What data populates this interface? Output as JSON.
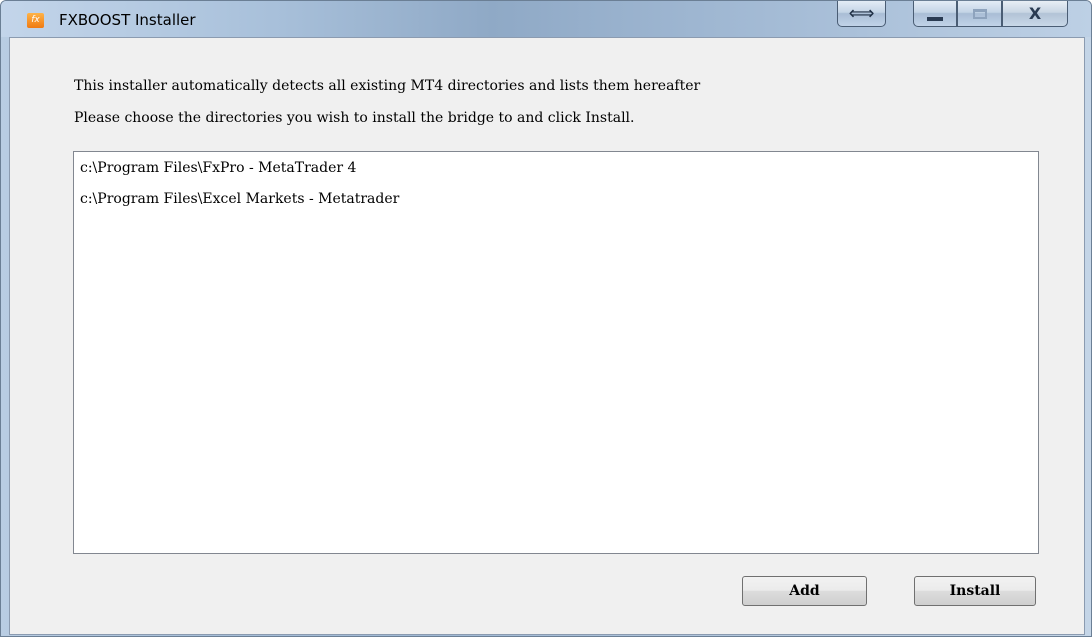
{
  "window": {
    "title": "FXBOOST Installer",
    "icon_text": "fx",
    "caption_buttons": {
      "resize_glyph": "⟺",
      "close_glyph": "X"
    }
  },
  "main": {
    "instruction_line1": "This installer automatically detects all existing MT4 directories and lists them hereafter",
    "instruction_line2": "Please choose the directories you wish to install the bridge to and click Install.",
    "directories": [
      "c:\\Program Files\\FxPro - MetaTrader 4",
      "c:\\Program Files\\Excel Markets - Metatrader"
    ]
  },
  "buttons": {
    "add_label": "Add",
    "install_label": "Install"
  },
  "colors": {
    "accent_icon": "#f07a12",
    "client_background": "#f0f0f0",
    "titlebar": "#a8c0da"
  },
  "icons": [
    "app-icon",
    "resize-icon",
    "minimize-icon",
    "maximize-icon",
    "close-icon"
  ]
}
